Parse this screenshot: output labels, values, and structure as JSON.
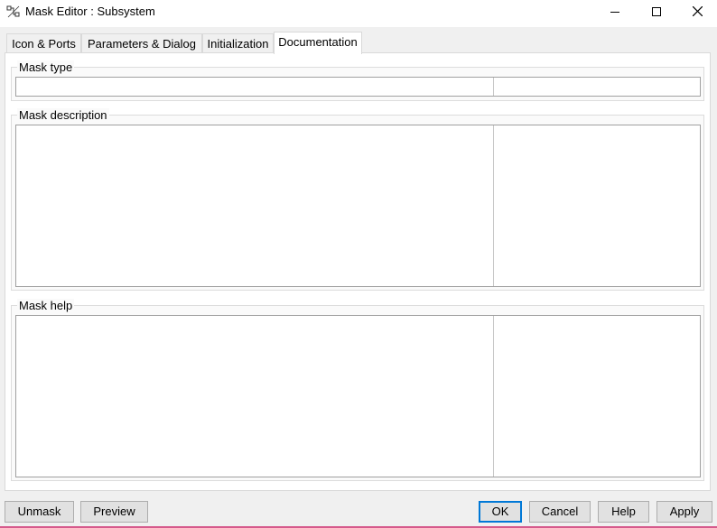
{
  "window": {
    "title": "Mask Editor : Subsystem",
    "controls": [
      "minimize-icon",
      "maximize-icon",
      "close-icon"
    ]
  },
  "tabs": [
    {
      "label": "Icon & Ports",
      "active": false
    },
    {
      "label": "Parameters & Dialog",
      "active": false
    },
    {
      "label": "Initialization",
      "active": false
    },
    {
      "label": "Documentation",
      "active": true
    }
  ],
  "documentation": {
    "mask_type": {
      "label": "Mask type",
      "value": ""
    },
    "mask_description": {
      "label": "Mask description",
      "value": ""
    },
    "mask_help": {
      "label": "Mask help",
      "value": ""
    }
  },
  "buttons": {
    "unmask": "Unmask",
    "preview": "Preview",
    "ok": "OK",
    "cancel": "Cancel",
    "help": "Help",
    "apply": "Apply"
  },
  "colors": {
    "default_button_border": "#0078d7",
    "dialog_background": "#f0f0f0",
    "bottom_accent": "#d65a8c"
  }
}
